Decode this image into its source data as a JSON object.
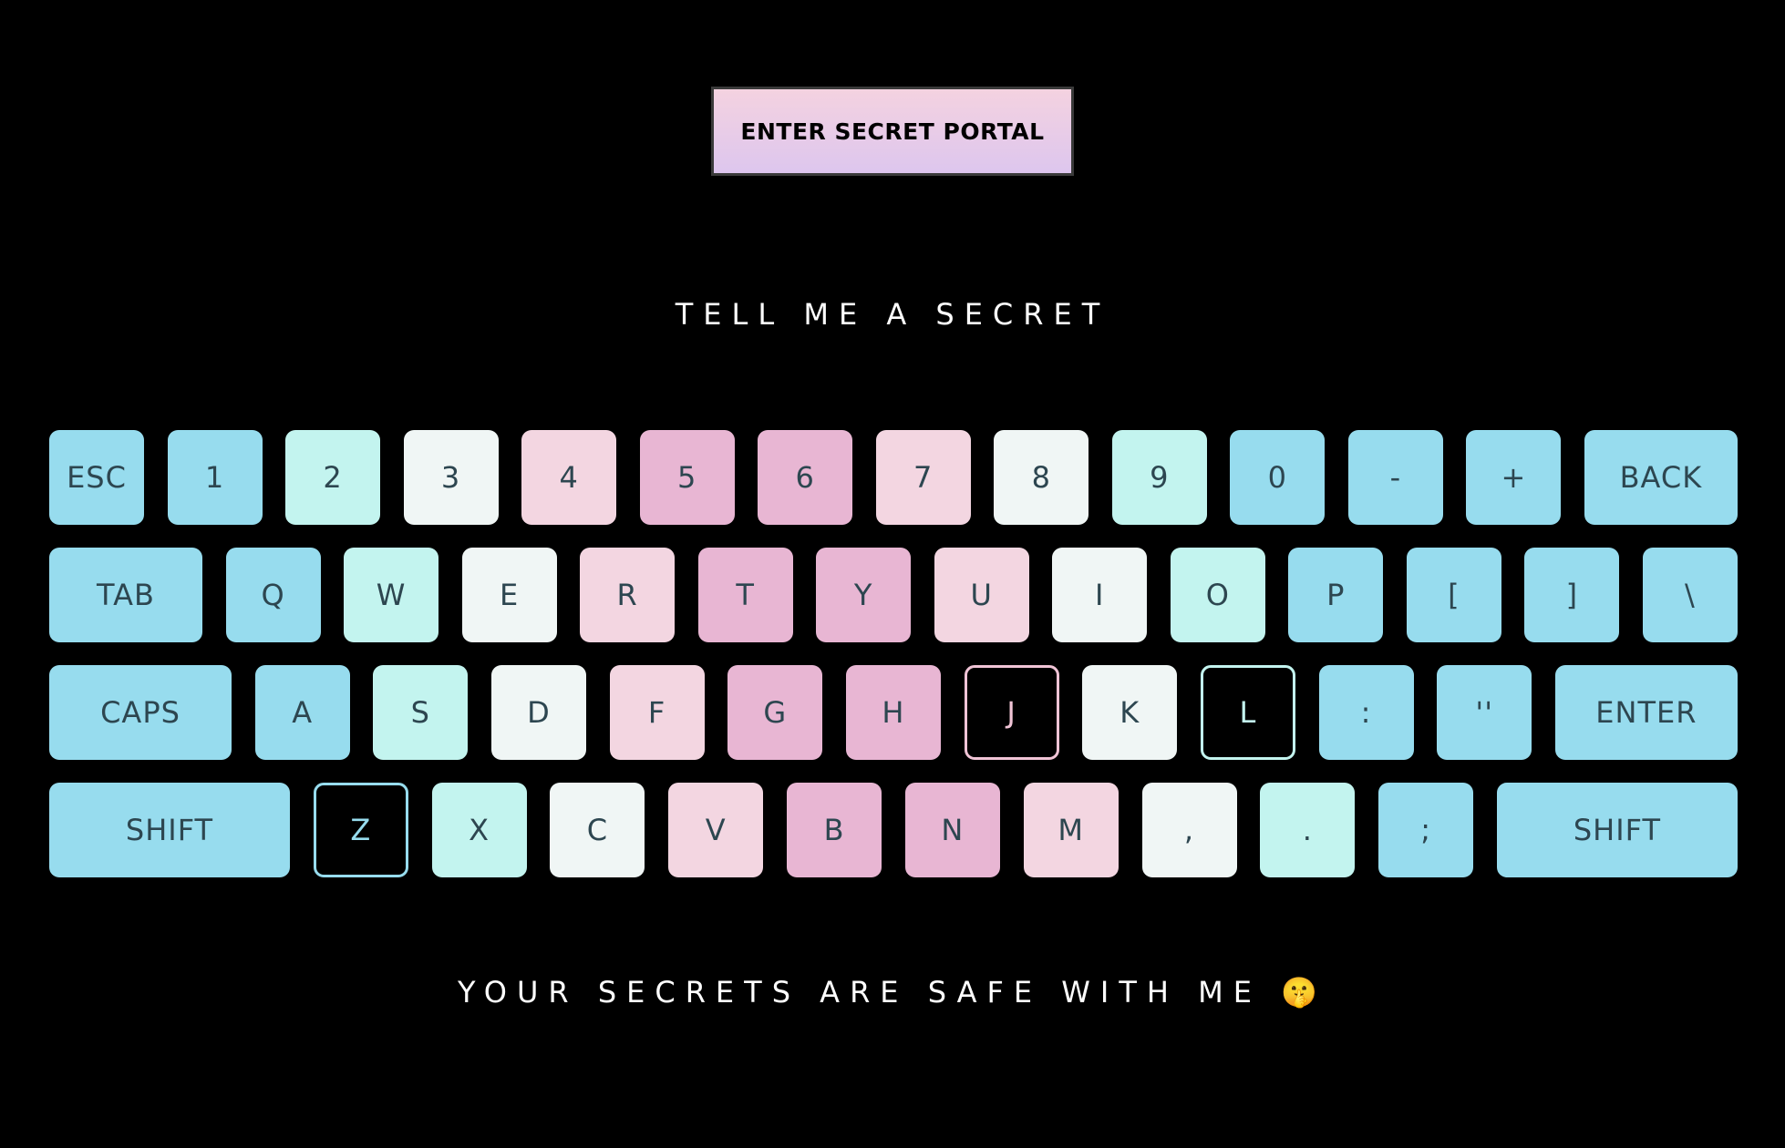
{
  "portal_button": {
    "label": "Enter Secret Portal"
  },
  "prompt": "TELL ME A SECRET",
  "footer": "YOUR SECRETS ARE SAFE WITH ME 🤫",
  "colors": {
    "background": "#000000",
    "blue": "#97dcee",
    "mint": "#c3f4ef",
    "white": "#f0f6f5",
    "light_pink": "#f3d6e1",
    "pink": "#e8b6d3"
  },
  "keyboard": {
    "row1": [
      "ESC",
      "1",
      "2",
      "3",
      "4",
      "5",
      "6",
      "7",
      "8",
      "9",
      "0",
      "-",
      "+",
      "BACK"
    ],
    "row2": [
      "TAB",
      "Q",
      "W",
      "E",
      "R",
      "T",
      "Y",
      "U",
      "I",
      "O",
      "P",
      "[",
      "]",
      "\\"
    ],
    "row3": [
      "CAPS",
      "A",
      "S",
      "D",
      "F",
      "G",
      "H",
      "J",
      "K",
      "L",
      ":",
      "''",
      "ENTER"
    ],
    "row4": [
      "SHIFT",
      "Z",
      "X",
      "C",
      "V",
      "B",
      "N",
      "M",
      ",",
      ".",
      ";",
      "SHIFT"
    ]
  }
}
